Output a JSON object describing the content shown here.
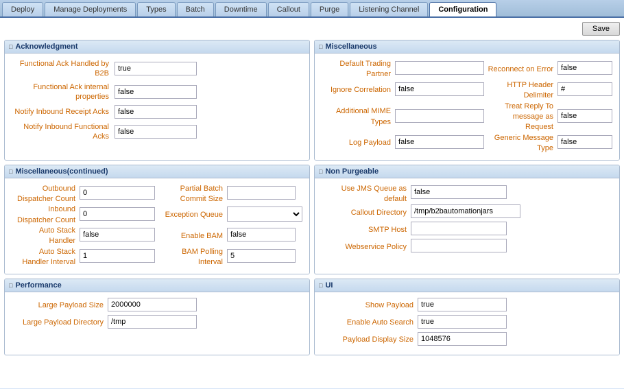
{
  "tabs": [
    {
      "id": "deploy",
      "label": "Deploy",
      "active": false
    },
    {
      "id": "manage",
      "label": "Manage Deployments",
      "active": false
    },
    {
      "id": "types",
      "label": "Types",
      "active": false
    },
    {
      "id": "batch",
      "label": "Batch",
      "active": false
    },
    {
      "id": "downtime",
      "label": "Downtime",
      "active": false
    },
    {
      "id": "callout",
      "label": "Callout",
      "active": false
    },
    {
      "id": "purge",
      "label": "Purge",
      "active": false
    },
    {
      "id": "listening",
      "label": "Listening Channel",
      "active": false
    },
    {
      "id": "configuration",
      "label": "Configuration",
      "active": true
    }
  ],
  "buttons": {
    "save": "Save"
  },
  "acknowledgment": {
    "header": "Acknowledgment",
    "fields": [
      {
        "label": "Functional Ack Handled by B2B",
        "value": "true"
      },
      {
        "label": "Functional Ack internal properties",
        "value": "false"
      },
      {
        "label": "Notify Inbound Receipt Acks",
        "value": "false"
      },
      {
        "label": "Notify Inbound Functional Acks",
        "value": "false"
      }
    ]
  },
  "miscellaneous": {
    "header": "Miscellaneous",
    "default_trading_partner_label": "Default Trading Partner",
    "default_trading_partner_value": "",
    "reconnect_on_error_label": "Reconnect on Error",
    "reconnect_on_error_value": "false",
    "ignore_correlation_label": "Ignore Correlation",
    "ignore_correlation_value": "false",
    "http_header_delimiter_label": "HTTP Header Delimiter",
    "http_header_delimiter_value": "#",
    "additional_mime_types_label": "Additional MIME Types",
    "additional_mime_types_value": "",
    "treat_reply_label": "Treat Reply To message as Request",
    "treat_reply_value": "false",
    "log_payload_label": "Log Payload",
    "log_payload_value": "false",
    "generic_message_type_label": "Generic Message Type",
    "generic_message_type_value": "false"
  },
  "miscellaneous_continued": {
    "header": "Miscellaneous(continued)",
    "outbound_dispatcher_count_label": "Outbound Dispatcher Count",
    "outbound_dispatcher_count_value": "0",
    "partial_batch_commit_size_label": "Partial Batch Commit Size",
    "partial_batch_commit_size_value": "",
    "inbound_dispatcher_count_label": "Inbound Dispatcher Count",
    "inbound_dispatcher_count_value": "0",
    "exception_queue_label": "Exception Queue",
    "exception_queue_value": "",
    "enable_bam_label": "Enable BAM",
    "enable_bam_value": "false",
    "auto_stack_handler_label": "Auto Stack Handler",
    "auto_stack_handler_value": "false",
    "bam_polling_interval_label": "BAM Polling Interval",
    "bam_polling_interval_value": "5",
    "auto_stack_handler_interval_label": "Auto Stack Handler Interval",
    "auto_stack_handler_interval_value": "1"
  },
  "non_purgeable": {
    "header": "Non Purgeable",
    "use_jms_queue_label": "Use JMS Queue as default",
    "use_jms_queue_value": "false",
    "callout_directory_label": "Callout Directory",
    "callout_directory_value": "/tmp/b2bautomationjars",
    "smtp_host_label": "SMTP Host",
    "smtp_host_value": "",
    "webservice_policy_label": "Webservice Policy",
    "webservice_policy_value": ""
  },
  "performance": {
    "header": "Performance",
    "large_payload_size_label": "Large Payload Size",
    "large_payload_size_value": "2000000",
    "large_payload_directory_label": "Large Payload Directory",
    "large_payload_directory_value": "/tmp"
  },
  "ui": {
    "header": "UI",
    "show_payload_label": "Show Payload",
    "show_payload_value": "true",
    "enable_auto_search_label": "Enable Auto Search",
    "enable_auto_search_value": "true",
    "payload_display_size_label": "Payload Display Size",
    "payload_display_size_value": "1048576"
  }
}
